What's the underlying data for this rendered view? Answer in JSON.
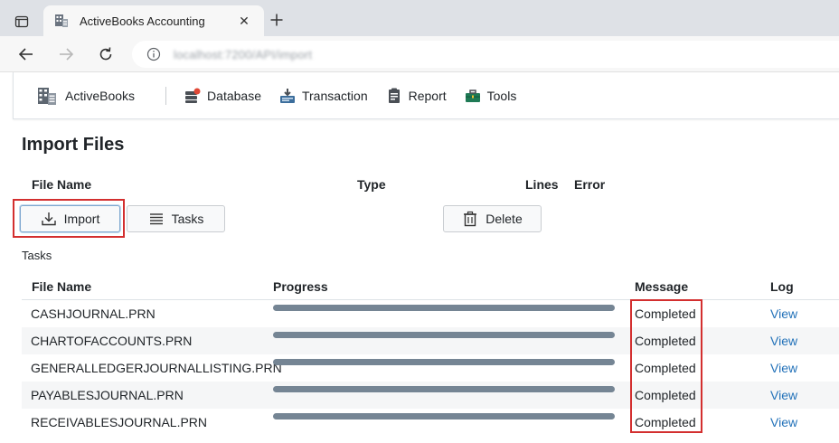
{
  "browser": {
    "tab_title": "ActiveBooks Accounting",
    "tab_close": "✕",
    "address": "localhost:7200/API/import"
  },
  "app_nav": {
    "brand": "ActiveBooks",
    "items": [
      {
        "name": "database",
        "label": "Database",
        "icon": "database-icon"
      },
      {
        "name": "transaction",
        "label": "Transaction",
        "icon": "transaction-icon"
      },
      {
        "name": "report",
        "label": "Report",
        "icon": "report-icon"
      },
      {
        "name": "tools",
        "label": "Tools",
        "icon": "tools-icon"
      }
    ]
  },
  "page": {
    "title": "Import Files",
    "file_headers": {
      "file_name": "File Name",
      "type": "Type",
      "lines": "Lines",
      "error": "Error"
    },
    "buttons": {
      "import": "Import",
      "tasks": "Tasks",
      "delete": "Delete"
    },
    "tasks_label": "Tasks"
  },
  "tasks_table": {
    "columns": {
      "file_name": "File Name",
      "progress": "Progress",
      "message": "Message",
      "log": "Log"
    },
    "rows": [
      {
        "file_name": "CASHJOURNAL.PRN",
        "progress": 100,
        "message": "Completed",
        "log": "View"
      },
      {
        "file_name": "CHARTOFACCOUNTS.PRN",
        "progress": 100,
        "message": "Completed",
        "log": "View"
      },
      {
        "file_name": "GENERALLEDGERJOURNALLISTING.PRN",
        "progress": 100,
        "message": "Completed",
        "log": "View"
      },
      {
        "file_name": "PAYABLESJOURNAL.PRN",
        "progress": 100,
        "message": "Completed",
        "log": "View"
      },
      {
        "file_name": "RECEIVABLESJOURNAL.PRN",
        "progress": 100,
        "message": "Completed",
        "log": "View"
      }
    ]
  },
  "colors": {
    "progress": "#758594",
    "link": "#2372b9",
    "highlight": "#d32f2f"
  }
}
